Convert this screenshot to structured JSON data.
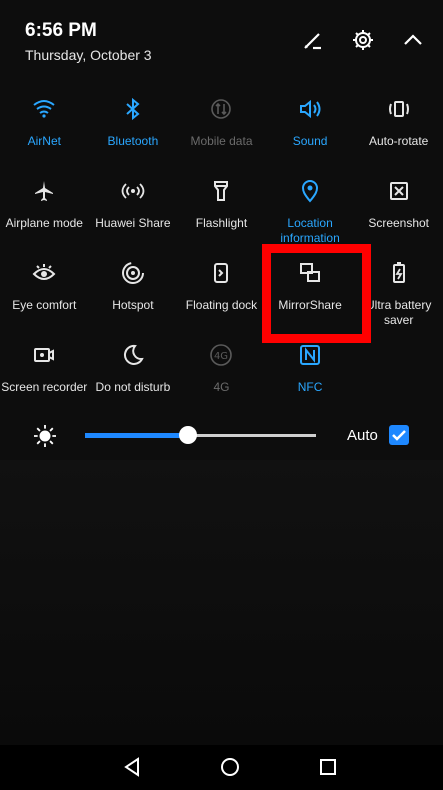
{
  "status": {
    "time": "6:56 PM",
    "date": "Thursday, October 3"
  },
  "top_icons": [
    "edit-icon",
    "settings-icon",
    "collapse-icon"
  ],
  "tiles": [
    {
      "label": "AirNet",
      "icon": "wifi-icon",
      "state": "active"
    },
    {
      "label": "Bluetooth",
      "icon": "bluetooth-icon",
      "state": "active"
    },
    {
      "label": "Mobile data",
      "icon": "mobile-data-icon",
      "state": "disabled"
    },
    {
      "label": "Sound",
      "icon": "sound-icon",
      "state": "active"
    },
    {
      "label": "Auto-rotate",
      "icon": "auto-rotate-icon",
      "state": "normal"
    },
    {
      "label": "Airplane mode",
      "icon": "airplane-icon",
      "state": "normal"
    },
    {
      "label": "Huawei Share",
      "icon": "huawei-share-icon",
      "state": "normal"
    },
    {
      "label": "Flashlight",
      "icon": "flashlight-icon",
      "state": "normal"
    },
    {
      "label": "Location information",
      "icon": "location-icon",
      "state": "active"
    },
    {
      "label": "Screenshot",
      "icon": "screenshot-icon",
      "state": "normal"
    },
    {
      "label": "Eye comfort",
      "icon": "eye-comfort-icon",
      "state": "normal"
    },
    {
      "label": "Hotspot",
      "icon": "hotspot-icon",
      "state": "normal"
    },
    {
      "label": "Floating dock",
      "icon": "floating-dock-icon",
      "state": "normal"
    },
    {
      "label": "MirrorShare",
      "icon": "mirrorshare-icon",
      "state": "normal"
    },
    {
      "label": "Ultra battery saver",
      "icon": "battery-saver-icon",
      "state": "normal"
    },
    {
      "label": "Screen recorder",
      "icon": "screen-recorder-icon",
      "state": "normal"
    },
    {
      "label": "Do not disturb",
      "icon": "do-not-disturb-icon",
      "state": "normal"
    },
    {
      "label": "4G",
      "icon": "4g-icon",
      "state": "disabled"
    },
    {
      "label": "NFC",
      "icon": "nfc-icon",
      "state": "active"
    }
  ],
  "brightness": {
    "level": 0.42,
    "auto_label": "Auto",
    "auto_checked": true
  },
  "colors": {
    "accent": "#2aa7ff",
    "highlight": "#ff0000"
  },
  "nav": [
    "back-icon",
    "home-icon",
    "recents-icon"
  ]
}
